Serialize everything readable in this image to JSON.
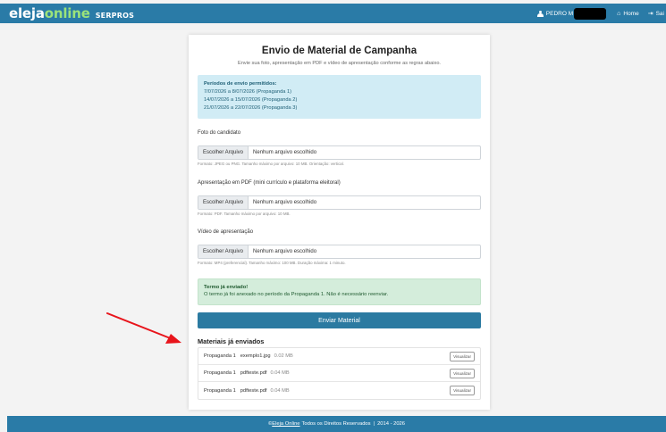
{
  "header": {
    "brand_main": "eleja",
    "brand_accent": "online",
    "brand_org": "SERPROS",
    "user_name": "PEDRO M",
    "home_label": "Home",
    "exit_label": "Sai"
  },
  "card": {
    "title": "Envio de Material de Campanha",
    "subtitle": "Envie sua foto, apresentação em PDF e vídeo de apresentação conforme as regras abaixo."
  },
  "periods": {
    "heading": "Períodos de envio permitidos:",
    "items": [
      "7/07/2026 a 8/07/2026 (Propaganda 1)",
      "14/07/2026 a 15/07/2026 (Propaganda 2)",
      "21/07/2026 a 22/07/2026 (Propaganda 3)"
    ]
  },
  "fields": [
    {
      "label": "Foto do candidato",
      "button": "Escolher Arquivo",
      "value": "Nenhum arquivo escolhido",
      "help": "Formato: JPEG ou PNG. Tamanho máximo por arquivo: 10 MB. Orientação: vertical."
    },
    {
      "label": "Apresentação em PDF (mini currículo e plataforma eleitoral)",
      "button": "Escolher Arquivo",
      "value": "Nenhum arquivo escolhido",
      "help": "Formato: PDF. Tamanho máximo por arquivo: 10 MB."
    },
    {
      "label": "Vídeo de apresentação",
      "button": "Escolher Arquivo",
      "value": "Nenhum arquivo escolhido",
      "help": "Formato: MP4 (preferencial). Tamanho máximo: 100 MB. Duração máxima: 1 minuto."
    }
  ],
  "notice": {
    "heading": "Termo já enviado!",
    "text": "O termo já foi anexado no período da Propaganda 1. Não é necessário reenviar."
  },
  "submit_label": "Enviar Material",
  "sent": {
    "title": "Materiais já enviados",
    "view_label": "Visualizar",
    "items": [
      {
        "phase": "Propaganda 1",
        "file": "exemplo1.jpg",
        "size": "0.02 MB"
      },
      {
        "phase": "Propaganda 1",
        "file": "pdfteste.pdf",
        "size": "0.04 MB"
      },
      {
        "phase": "Propaganda 1",
        "file": "pdfteste.pdf",
        "size": "0.04 MB"
      }
    ]
  },
  "footer": {
    "copyright": "©",
    "link": "Eleja Online",
    "rights": "Todos os Direitos Reservados",
    "separator": "|",
    "years": "2014 - 2026"
  },
  "colors": {
    "primary": "#2a7ba7",
    "brand_accent": "#9be37a",
    "info_bg": "#d1ecf5",
    "success_bg": "#d4eddb",
    "annotation_arrow": "#e8141b"
  },
  "icons": {
    "user": "user-icon",
    "home": "home-icon",
    "exit": "sign-out-icon",
    "arrow": "red-arrow-annotation"
  }
}
